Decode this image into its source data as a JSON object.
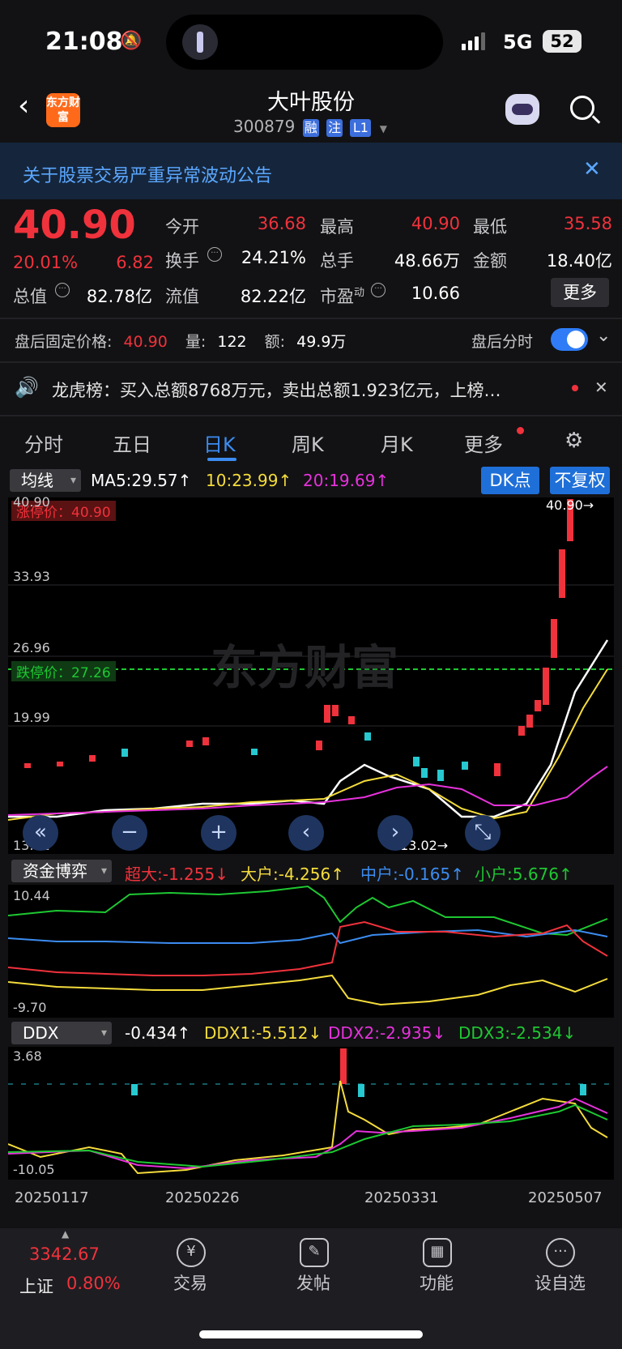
{
  "status": {
    "time": "21:08",
    "network": "5G",
    "battery": "52"
  },
  "header": {
    "logo_text": "东方财富",
    "title": "大叶股份",
    "code": "300879",
    "tags": [
      "融",
      "注",
      "L1"
    ]
  },
  "notice": {
    "text": "关于股票交易严重异常波动公告"
  },
  "quote": {
    "price": "40.90",
    "change_pct": "20.01%",
    "change": "6.82",
    "open_label": "今开",
    "open": "36.68",
    "high_label": "最高",
    "high": "40.90",
    "low_label": "最低",
    "low": "35.58",
    "turnover_label": "换手",
    "turnover": "24.21%",
    "volume_label": "总手",
    "volume": "48.66万",
    "amount_label": "金额",
    "amount": "18.40亿",
    "mcap_label": "总值",
    "mcap": "82.78亿",
    "float_label": "流值",
    "float": "82.22亿",
    "pe_label": "市盈",
    "pe_sup": "动",
    "pe": "10.66",
    "more": "更多"
  },
  "after_hours": {
    "price_label": "盘后固定价格:",
    "price": "40.90",
    "vol_label": "量:",
    "vol": "122",
    "amt_label": "额:",
    "amt": "49.9万",
    "timeshare_label": "盘后分时"
  },
  "dragon": {
    "text": "龙虎榜：买入总额8768万元，卖出总额1.923亿元，上榜…"
  },
  "tabs": [
    "分时",
    "五日",
    "日K",
    "周K",
    "月K",
    "更多"
  ],
  "kline": {
    "indicator": "均线",
    "ma5": "MA5:29.57↑",
    "ma10": "10:23.99↑",
    "ma20": "20:19.69↑",
    "dk_button": "DK点",
    "adjust_button": "不复权",
    "y_labels": [
      "40.90",
      "33.93",
      "26.96",
      "19.99",
      "13.02"
    ],
    "limit_up": "涨停价：40.90",
    "limit_down": "跌停价：27.26",
    "max_marker": "40.90→",
    "min_marker": "13.02→",
    "watermark": "东方财富"
  },
  "fund": {
    "indicator": "资金博弈",
    "super": "超大:-1.255↓",
    "big": "大户:-4.256↑",
    "mid": "中户:-0.165↑",
    "small": "小户:5.676↑",
    "y_max": "10.44",
    "y_min": "-9.70"
  },
  "ddx": {
    "indicator": "DDX",
    "ddx": "-0.434↑",
    "ddx1": "DDX1:-5.512↓",
    "ddx2": "DDX2:-2.935↓",
    "ddx3": "DDX3:-2.534↓",
    "y_max": "3.68",
    "y_min": "-10.05"
  },
  "dates": [
    "20250117",
    "20250226",
    "20250331",
    "20250507"
  ],
  "bottom": {
    "index_value": "3342.67",
    "index_name": "上证",
    "index_change": "0.80%",
    "items": [
      "交易",
      "发帖",
      "功能",
      "设自选"
    ]
  },
  "colors": {
    "up": "#f0323c",
    "down": "#1ec832",
    "accent": "#3c8cf0"
  }
}
